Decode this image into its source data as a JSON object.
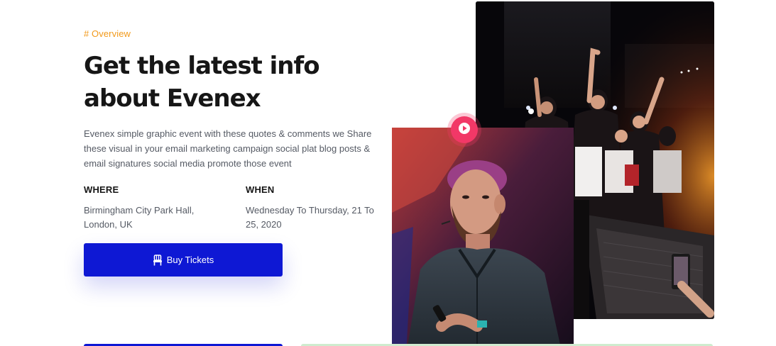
{
  "overview": {
    "eyebrow": "# Overview",
    "title": "Get the latest info about Evenex",
    "description": "Evenex simple graphic event with these quotes & comments we Share these visual in your email marketing campaign social plat blog posts & email signatures social media promote those event"
  },
  "where": {
    "label": "WHERE",
    "value": "Birmingham City Park Hall, London, UK"
  },
  "when": {
    "label": "WHEN",
    "value": "Wednesday To Thursday, 21 To 25, 2020"
  },
  "cta": {
    "label": "Buy Tickets",
    "icon": "ticket-seat-icon"
  },
  "media": {
    "play_icon": "play-icon",
    "accent": "#f23867"
  },
  "colors": {
    "primary": "#0e18d4",
    "eyebrow": "#f29a1b",
    "heading": "#161616",
    "body": "#555a64"
  }
}
